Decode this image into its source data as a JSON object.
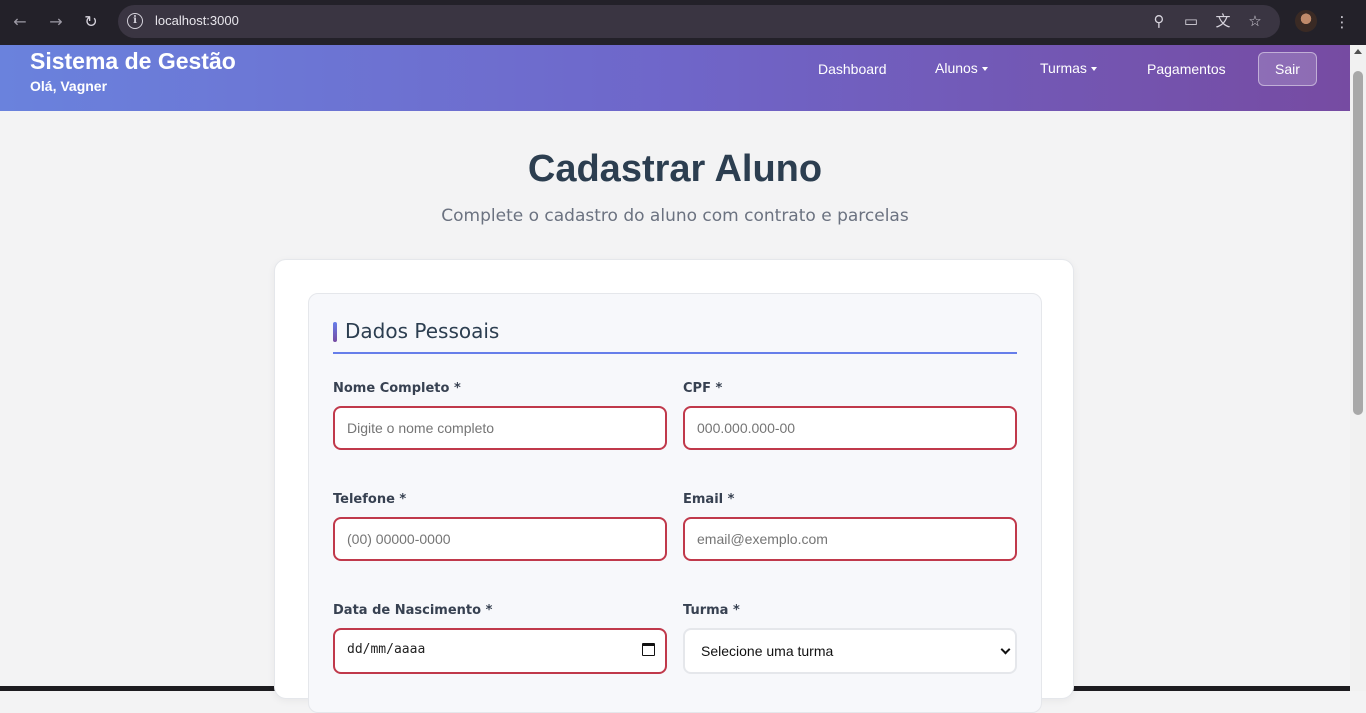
{
  "browser": {
    "url": "localhost:3000",
    "back_icon": "arrow-left-icon",
    "forward_icon": "arrow-right-icon",
    "reload_icon": "reload-icon"
  },
  "header": {
    "brand": "Sistema de Gestão",
    "greeting": "Olá, Vagner",
    "menu": [
      "Dashboard",
      "Alunos",
      "Turmas",
      "Pagamentos"
    ],
    "logout": "Sair"
  },
  "page": {
    "title": "Cadastrar Aluno",
    "subtitle": "Complete o cadastro do aluno com contrato e parcelas"
  },
  "section": {
    "title": "Dados Pessoais",
    "fields": {
      "nome": {
        "label": "Nome Completo *",
        "placeholder": "Digite o nome completo"
      },
      "cpf": {
        "label": "CPF *",
        "placeholder": "000.000.000-00"
      },
      "telefone": {
        "label": "Telefone *",
        "placeholder": "(00) 00000-0000"
      },
      "email": {
        "label": "Email *",
        "placeholder": "email@exemplo.com"
      },
      "nascimento": {
        "label": "Data de Nascimento *",
        "value": "dd/mm/aaaa"
      },
      "turma": {
        "label": "Turma *",
        "value": "Selecione uma turma"
      }
    }
  }
}
